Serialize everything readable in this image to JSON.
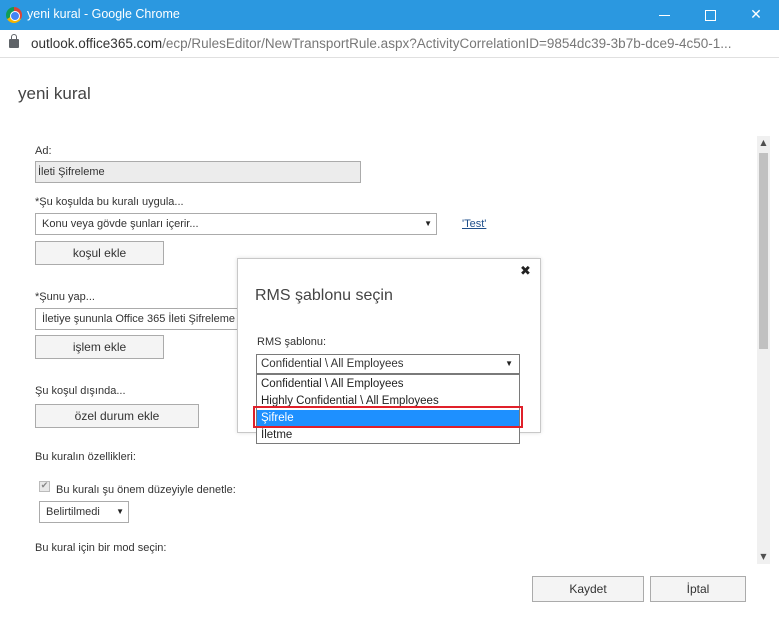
{
  "window": {
    "title": "yeni kural - Google Chrome"
  },
  "address": {
    "host": "outlook.office365.com",
    "path": "/ecp/RulesEditor/NewTransportRule.aspx?ActivityCorrelationID=9854dc39-3b7b-dce9-4c50-1..."
  },
  "page": {
    "title": "yeni kural"
  },
  "form": {
    "name_label": "Ad:",
    "name_value": "İleti Şifreleme",
    "condition_label": "*Şu koşulda bu kuralı uygula...",
    "condition_value": "Konu veya gövde şunları içerir...",
    "test_link": "'Test'",
    "add_condition": "koşul ekle",
    "action_label": "*Şunu yap...",
    "action_value": "İletiye şununla Office 365 İleti Şifreleme",
    "add_action": "işlem ekle",
    "exception_label": "Şu koşul dışında...",
    "add_exception": "özel durum ekle",
    "properties_label": "Bu kuralın özellikleri:",
    "audit_label": "Bu kuralı şu önem düzeyiyle denetle:",
    "severity_value": "Belirtilmedi",
    "mode_label": "Bu kural için bir mod seçin:"
  },
  "dialog": {
    "title": "RMS şablonu seçin",
    "field_label": "RMS şablonu:",
    "selected": "Confidential \\ All Employees",
    "options": [
      "Confidential \\ All Employees",
      "Highly Confidential \\ All Employees",
      "Şifrele",
      "İletme"
    ],
    "highlighted_index": 2
  },
  "footer": {
    "save": "Kaydet",
    "cancel": "İptal"
  }
}
